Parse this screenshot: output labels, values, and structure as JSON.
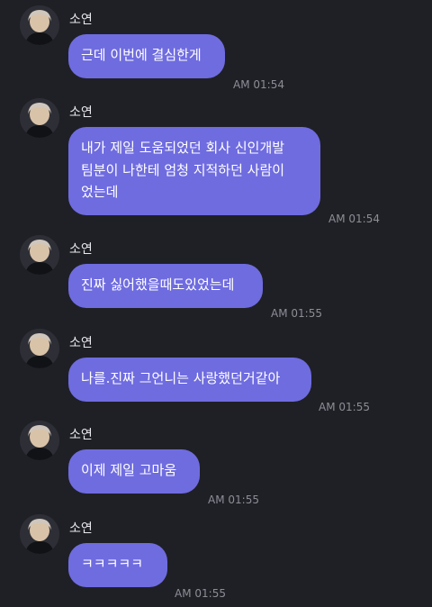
{
  "sender_name": "소연",
  "messages": [
    {
      "text": "근데 이번에 결심한게",
      "time": "AM 01:54"
    },
    {
      "text": "내가 제일 도움되었던 회사 신인개발\n팀분이 나한테 엄청 지적하던 사람이\n었는데",
      "time": "AM 01:54"
    },
    {
      "text": "진짜 싫어했을때도있었는데",
      "time": "AM 01:55"
    },
    {
      "text": "나를.진짜 그언니는 사랑했던거같아",
      "time": "AM 01:55"
    },
    {
      "text": "이제 제일 고마움",
      "time": "AM 01:55"
    },
    {
      "text": "ㅋㅋㅋㅋㅋ",
      "time": "AM 01:55"
    }
  ],
  "colors": {
    "background": "#1f2026",
    "bubble": "#6f6ce0",
    "bubble_text": "#ffffff",
    "timestamp": "#8d8d96",
    "sender": "#e9e9ee"
  }
}
